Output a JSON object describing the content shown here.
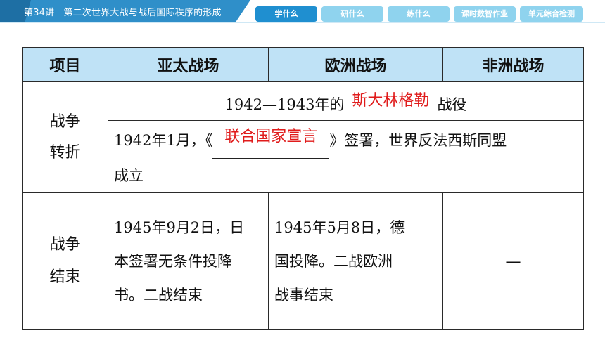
{
  "header": {
    "lesson": "第34讲",
    "title": "第二次世界大战与战后国际秩序的形成",
    "tabs": [
      {
        "label": "学什么",
        "active": true
      },
      {
        "label": "研什么",
        "active": false
      },
      {
        "label": "练什么",
        "active": false
      },
      {
        "label": "课时数智作业",
        "active": false
      },
      {
        "label": "单元综合检测",
        "active": false
      }
    ]
  },
  "table": {
    "columns": [
      "项目",
      "亚太战场",
      "欧洲战场",
      "非洲战场"
    ],
    "turning_label": "战争转折",
    "turning_label_l1": "战争",
    "turning_label_l2": "转折",
    "turning_row1_pre": "1942—1943年的",
    "turning_row1_answer": "斯大林格勒",
    "turning_row1_post": "战役",
    "turning_row2_pre": "1942年1月，《",
    "turning_row2_answer": "联合国家宣言",
    "turning_row2_post": "》签署，世界反法西斯同盟",
    "turning_row2_line2": "成立",
    "end_label_l1": "战争",
    "end_label_l2": "结束",
    "end_asia_l1": "1945年9月2日，日",
    "end_asia_l2": "本签署无条件投降",
    "end_asia_l3": "书。二战结束",
    "end_europe_l1": "1945年5月8日，德",
    "end_europe_l2": "国投降。二战欧洲",
    "end_europe_l3": "战事结束",
    "end_africa": "—"
  },
  "colors": {
    "header_bar": "#2f8fc9",
    "tab_active": "#1f8fd0",
    "tab_inactive": "#8fd3ee",
    "table_header_bg": "#bfe2f6",
    "answer_red": "#e01b1b"
  }
}
